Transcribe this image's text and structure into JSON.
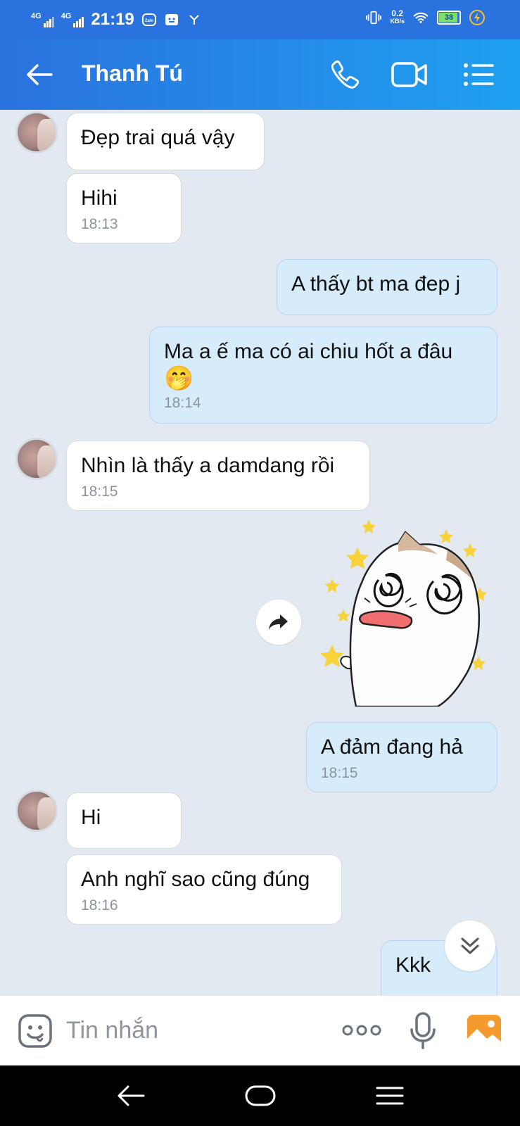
{
  "status_bar": {
    "network_1": "4G",
    "network_2": "4G",
    "time": "21:19",
    "data_speed_value": "0.2",
    "data_speed_unit": "KB/s",
    "battery": "38"
  },
  "header": {
    "title": "Thanh Tú",
    "icons": [
      "back-arrow-icon",
      "phone-icon",
      "video-call-icon",
      "menu-list-icon"
    ]
  },
  "messages": [
    {
      "text": "Đẹp trai quá vậy",
      "time": ""
    },
    {
      "text": "Hihi",
      "time": "18:13"
    },
    {
      "text": "A thấy bt ma đep j",
      "time": ""
    },
    {
      "text": "Ma a ế ma có ai chiu hốt a đâu",
      "emoji": "🤭",
      "time": "18:14"
    },
    {
      "text": "Nhìn là thấy a damdang rồi",
      "time": "18:15"
    },
    {
      "text": "A đảm đang hả",
      "time": "18:15"
    },
    {
      "text": "Hi",
      "time": ""
    },
    {
      "text": "Anh nghĩ sao cũng đúng",
      "time": "18:16"
    },
    {
      "text": "Kkk",
      "time": ""
    }
  ],
  "input": {
    "placeholder": "Tin nhắn"
  },
  "colors": {
    "header_start": "#2a72de",
    "header_end": "#1fa0f0",
    "chat_bg": "#e2e9f1",
    "outgoing_bubble": "#d6ecfb",
    "incoming_bubble": "#ffffff",
    "gallery_icon": "#f59a2d"
  }
}
